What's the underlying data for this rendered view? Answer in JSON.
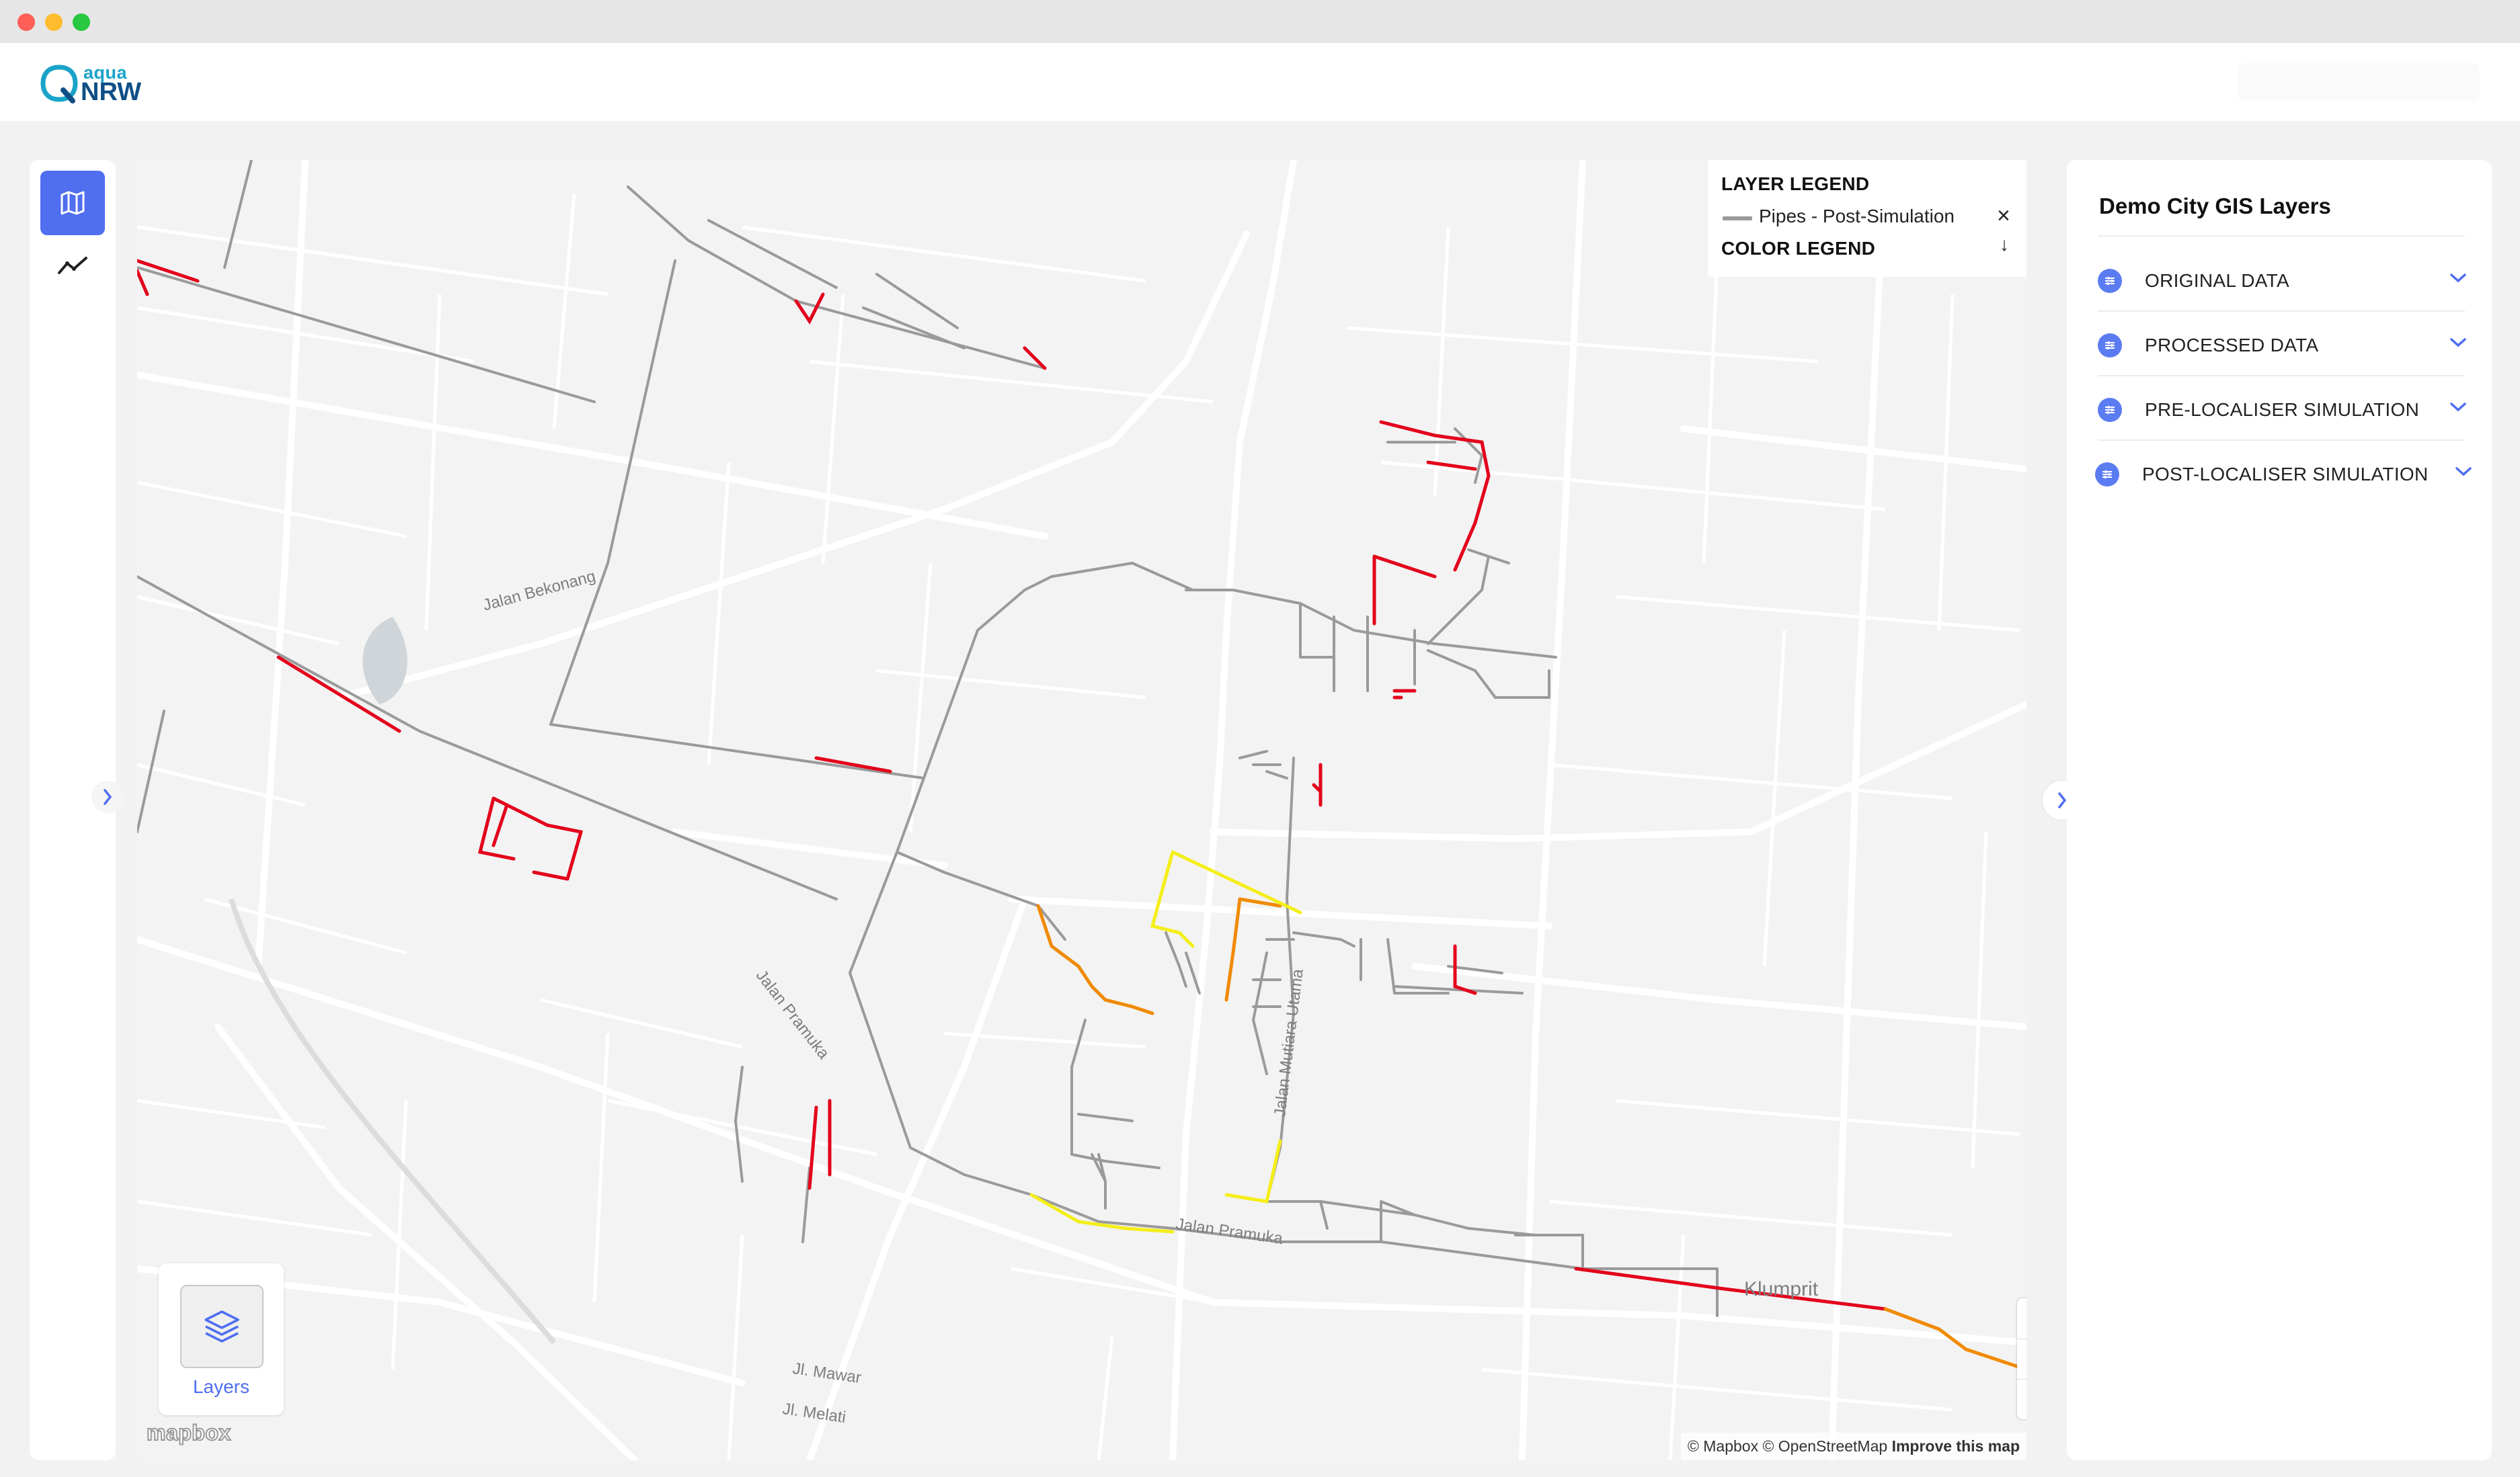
{
  "header": {
    "logo_top": "aqua",
    "logo_bottom": "NRW"
  },
  "map": {
    "street_labels": [
      "Jalan Bekonang",
      "Jalan Pramuka",
      "Jalan Pramuka",
      "Jalan Mutiara Utama",
      "Jl. Mawar",
      "Jl. Melati",
      "Klumprit"
    ],
    "layer_legend": {
      "title": "LAYER LEGEND",
      "item_label": "Pipes - Post-Simulation",
      "color_legend_title": "COLOR LEGEND"
    },
    "layers_button_label": "Layers",
    "mapbox_logo": "mapbox",
    "attribution": {
      "text": "© Mapbox © OpenStreetMap",
      "improve": "Improve this map"
    },
    "pipe_colors": {
      "default": "#9a9a9a",
      "red": "#e3001b",
      "orange": "#f08a00",
      "yellow": "#f4ee1a"
    }
  },
  "right_panel": {
    "title": "Demo City GIS Layers",
    "items": [
      {
        "label": "ORIGINAL DATA"
      },
      {
        "label": "PROCESSED DATA"
      },
      {
        "label": "PRE-LOCALISER SIMULATION"
      },
      {
        "label": "POST-LOCALISER SIMULATION"
      }
    ]
  },
  "colors": {
    "accent": "#4f6ef0",
    "logo_light": "#1aa3c9",
    "logo_dark": "#0f4f86"
  }
}
